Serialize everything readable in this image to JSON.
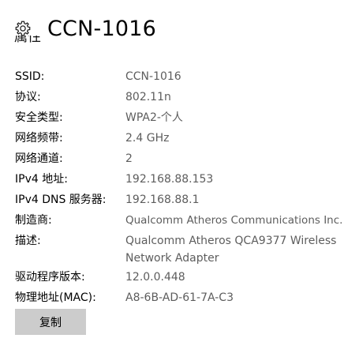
{
  "header": {
    "icon": "gear-icon",
    "title": "CCN-1016"
  },
  "section": {
    "label": "属性"
  },
  "properties": [
    {
      "key": "SSID:",
      "value": "CCN-1016"
    },
    {
      "key": "协议:",
      "value": "802.11n"
    },
    {
      "key": "安全类型:",
      "value": "WPA2-个人"
    },
    {
      "key": "网络频带:",
      "value": "2.4 GHz"
    },
    {
      "key": "网络通道:",
      "value": "2"
    },
    {
      "key": "IPv4 地址:",
      "value": "192.168.88.153"
    },
    {
      "key": "IPv4 DNS 服务器:",
      "value": "192.168.88.1"
    },
    {
      "key": "制造商:",
      "value": "Qualcomm Atheros Communications Inc."
    },
    {
      "key": "描述:",
      "value": "Qualcomm Atheros QCA9377 Wireless Network Adapter"
    },
    {
      "key": "驱动程序版本:",
      "value": "12.0.0.448"
    },
    {
      "key": "物理地址(MAC):",
      "value": "A8-6B-AD-61-7A-C3"
    }
  ],
  "actions": {
    "copy_label": "复制"
  }
}
